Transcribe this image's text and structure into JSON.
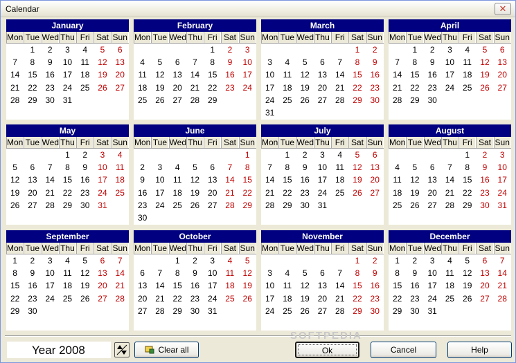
{
  "window": {
    "title": "Calendar",
    "close_glyph": "✕"
  },
  "day_headers": [
    "Mon",
    "Tue",
    "Wed",
    "Thu",
    "Fri",
    "Sat",
    "Sun"
  ],
  "months": [
    {
      "name": "January",
      "days": [
        "",
        "1",
        "2",
        "3",
        "4",
        "5",
        "6",
        "7",
        "8",
        "9",
        "10",
        "11",
        "12",
        "13",
        "14",
        "15",
        "16",
        "17",
        "18",
        "19",
        "20",
        "21",
        "22",
        "23",
        "24",
        "25",
        "26",
        "27",
        "28",
        "29",
        "30",
        "31"
      ]
    },
    {
      "name": "February",
      "days": [
        "",
        "",
        "",
        "",
        "1",
        "2",
        "3",
        "4",
        "5",
        "6",
        "7",
        "8",
        "9",
        "10",
        "11",
        "12",
        "13",
        "14",
        "15",
        "16",
        "17",
        "18",
        "19",
        "20",
        "21",
        "22",
        "23",
        "24",
        "25",
        "26",
        "27",
        "28",
        "29"
      ]
    },
    {
      "name": "March",
      "days": [
        "",
        "",
        "",
        "",
        "",
        "1",
        "2",
        "3",
        "4",
        "5",
        "6",
        "7",
        "8",
        "9",
        "10",
        "11",
        "12",
        "13",
        "14",
        "15",
        "16",
        "17",
        "18",
        "19",
        "20",
        "21",
        "22",
        "23",
        "24",
        "25",
        "26",
        "27",
        "28",
        "29",
        "30",
        "31"
      ]
    },
    {
      "name": "April",
      "days": [
        "",
        "1",
        "2",
        "3",
        "4",
        "5",
        "6",
        "7",
        "8",
        "9",
        "10",
        "11",
        "12",
        "13",
        "14",
        "15",
        "16",
        "17",
        "18",
        "19",
        "20",
        "21",
        "22",
        "23",
        "24",
        "25",
        "26",
        "27",
        "28",
        "29",
        "30"
      ]
    },
    {
      "name": "May",
      "days": [
        "",
        "",
        "",
        "1",
        "2",
        "3",
        "4",
        "5",
        "6",
        "7",
        "8",
        "9",
        "10",
        "11",
        "12",
        "13",
        "14",
        "15",
        "16",
        "17",
        "18",
        "19",
        "20",
        "21",
        "22",
        "23",
        "24",
        "25",
        "26",
        "27",
        "28",
        "29",
        "30",
        "31"
      ]
    },
    {
      "name": "June",
      "days": [
        "",
        "",
        "",
        "",
        "",
        "",
        "1",
        "2",
        "3",
        "4",
        "5",
        "6",
        "7",
        "8",
        "9",
        "10",
        "11",
        "12",
        "13",
        "14",
        "15",
        "16",
        "17",
        "18",
        "19",
        "20",
        "21",
        "22",
        "23",
        "24",
        "25",
        "26",
        "27",
        "28",
        "29",
        "30"
      ]
    },
    {
      "name": "July",
      "days": [
        "",
        "1",
        "2",
        "3",
        "4",
        "5",
        "6",
        "7",
        "8",
        "9",
        "10",
        "11",
        "12",
        "13",
        "14",
        "15",
        "16",
        "17",
        "18",
        "19",
        "20",
        "21",
        "22",
        "23",
        "24",
        "25",
        "26",
        "27",
        "28",
        "29",
        "30",
        "31"
      ]
    },
    {
      "name": "August",
      "days": [
        "",
        "",
        "",
        "",
        "1",
        "2",
        "3",
        "4",
        "5",
        "6",
        "7",
        "8",
        "9",
        "10",
        "11",
        "12",
        "13",
        "14",
        "15",
        "16",
        "17",
        "18",
        "19",
        "20",
        "21",
        "22",
        "23",
        "24",
        "25",
        "26",
        "27",
        "28",
        "29",
        "30",
        "31"
      ]
    },
    {
      "name": "September",
      "days": [
        "1",
        "2",
        "3",
        "4",
        "5",
        "6",
        "7",
        "8",
        "9",
        "10",
        "11",
        "12",
        "13",
        "14",
        "15",
        "16",
        "17",
        "18",
        "19",
        "20",
        "21",
        "22",
        "23",
        "24",
        "25",
        "26",
        "27",
        "28",
        "29",
        "30"
      ]
    },
    {
      "name": "October",
      "days": [
        "",
        "",
        "1",
        "2",
        "3",
        "4",
        "5",
        "6",
        "7",
        "8",
        "9",
        "10",
        "11",
        "12",
        "13",
        "14",
        "15",
        "16",
        "17",
        "18",
        "19",
        "20",
        "21",
        "22",
        "23",
        "24",
        "25",
        "26",
        "27",
        "28",
        "29",
        "30",
        "31"
      ]
    },
    {
      "name": "November",
      "days": [
        "",
        "",
        "",
        "",
        "",
        "1",
        "2",
        "3",
        "4",
        "5",
        "6",
        "7",
        "8",
        "9",
        "10",
        "11",
        "12",
        "13",
        "14",
        "15",
        "16",
        "17",
        "18",
        "19",
        "20",
        "21",
        "22",
        "23",
        "24",
        "25",
        "26",
        "27",
        "28",
        "29",
        "30"
      ]
    },
    {
      "name": "December",
      "days": [
        "1",
        "2",
        "3",
        "4",
        "5",
        "6",
        "7",
        "8",
        "9",
        "10",
        "11",
        "12",
        "13",
        "14",
        "15",
        "16",
        "17",
        "18",
        "19",
        "20",
        "21",
        "22",
        "23",
        "24",
        "25",
        "26",
        "27",
        "28",
        "29",
        "30",
        "31"
      ]
    }
  ],
  "colors": {
    "header_bg": "#000080",
    "weekend": "#c00000"
  },
  "year": {
    "label": "Year 2008"
  },
  "buttons": {
    "clear_all": "Clear all",
    "ok": "Ok",
    "cancel": "Cancel",
    "help": "Help"
  },
  "watermark": "SOFTPEDIA"
}
